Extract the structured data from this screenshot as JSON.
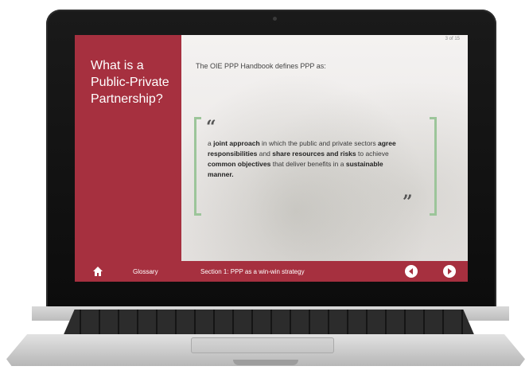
{
  "slide": {
    "title": "What is a Public-Private Partnership?",
    "page_counter": "3 of 15",
    "intro": "The OIE PPP Handbook defines PPP as:"
  },
  "quote": {
    "segments": [
      {
        "text": "a ",
        "bold": false
      },
      {
        "text": "joint approach",
        "bold": true
      },
      {
        "text": " in which the public and private sectors ",
        "bold": false
      },
      {
        "text": "agree responsibilities",
        "bold": true
      },
      {
        "text": " and ",
        "bold": false
      },
      {
        "text": "share resources and risks",
        "bold": true
      },
      {
        "text": " to achieve ",
        "bold": false
      },
      {
        "text": "common objectives",
        "bold": true
      },
      {
        "text": " that deliver benefits in a ",
        "bold": false
      },
      {
        "text": "sustainable manner.",
        "bold": true
      }
    ]
  },
  "bottom_bar": {
    "glossary": "Glossary",
    "section": "Section 1: PPP as a win-win strategy"
  },
  "icons": {
    "home": "home-icon",
    "prev": "arrow-left-circle-icon",
    "next": "arrow-right-circle-icon",
    "quote_open": "quote-open-icon",
    "quote_close": "quote-close-icon"
  },
  "colors": {
    "brand_maroon": "#a6303f",
    "bracket_green": "#9cc59a"
  }
}
